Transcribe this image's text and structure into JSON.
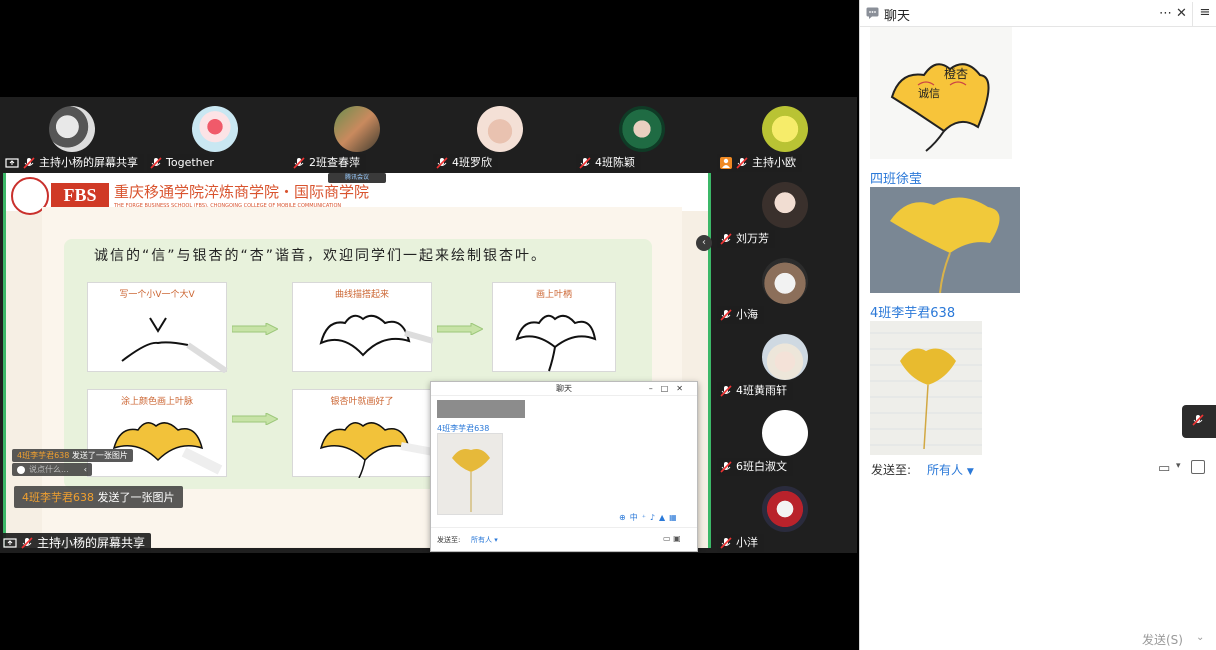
{
  "top_strip": [
    {
      "name": "主持小杨的屏幕共享",
      "share": true
    },
    {
      "name": "Together",
      "share": false
    },
    {
      "name": "2班查春萍",
      "share": false
    },
    {
      "name": "4班罗欣",
      "share": false
    },
    {
      "name": "4班陈颖",
      "share": false
    },
    {
      "name": "主持小欧",
      "share": false,
      "host": true
    }
  ],
  "right_strip": [
    {
      "name": "刘万芳"
    },
    {
      "name": "小海"
    },
    {
      "name": "4班黄雨轩"
    },
    {
      "name": "6班白淑文"
    },
    {
      "name": "小洋"
    }
  ],
  "slide": {
    "logo_text": "FBS",
    "school_cn": "重庆移通学院淬炼商学院・国际商学院",
    "school_en": "THE FORGE BUSINESS SCHOOL (FBS), CHONGQING COLLEGE OF MOBILE COMMUNICATION",
    "headline": "诚信的“信”与银杏的“杏”谐音，欢迎同学们一起来绘制银杏叶。",
    "steps": [
      "写一个小V一个大V",
      "曲线描搭起来",
      "画上叶柄",
      "涂上颜色画上叶脉",
      "银杏叶就画好了"
    ],
    "meeting_badge": "腾讯会议"
  },
  "share_banner": "主持小杨的屏幕共享",
  "toast_small_a": {
    "sender": "4班李芋君638",
    "text": "发送了一张图片"
  },
  "toast_small_b": {
    "text": "说点什么..."
  },
  "toast_big": {
    "sender": "4班李芋君638",
    "text": "发送了一张图片"
  },
  "mini_chat": {
    "title": "聊天",
    "sender": "4班李芋君638",
    "send_to": "发送至:",
    "recipient": "所有人"
  },
  "chat": {
    "title": "聊天",
    "messages": [
      {
        "sender": "",
        "photo_text": "诚信",
        "photo_text2": "橙杏"
      },
      {
        "sender": "四班徐莹"
      },
      {
        "sender": "4班李芋君638"
      }
    ],
    "send_to_label": "发送至:",
    "recipient": "所有人",
    "send_button": "发送(S)"
  },
  "colors": {
    "accent_blue": "#2b79d8",
    "share_green": "#3cb868",
    "school_red": "#d03a26"
  }
}
